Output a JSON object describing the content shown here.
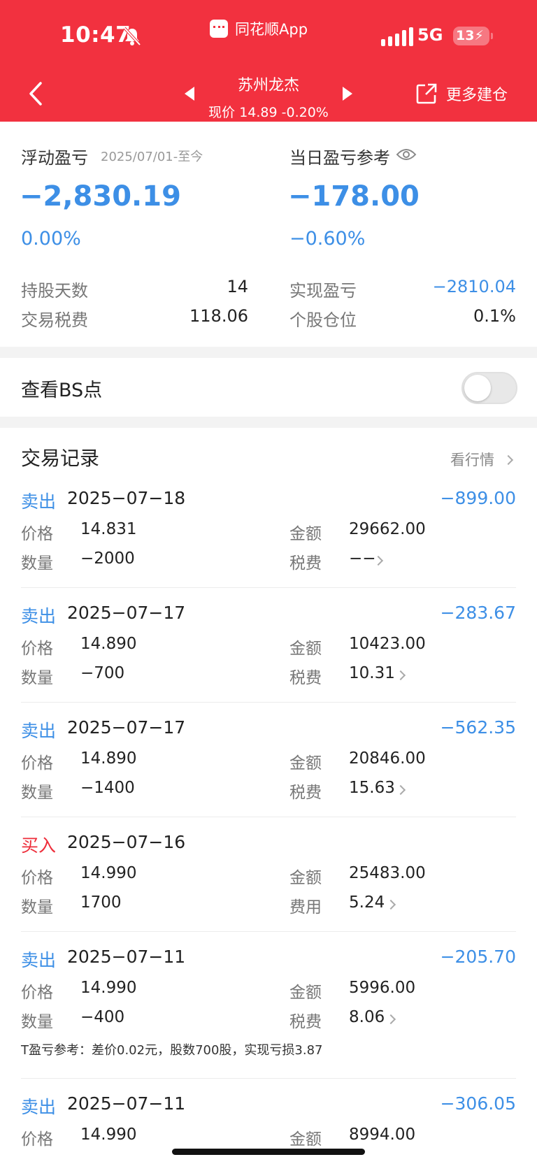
{
  "status_bar": {
    "time": "10:47",
    "network": "5G",
    "battery": "13"
  },
  "header": {
    "app_name": "同花顺App",
    "stock_name": "苏州龙杰",
    "price_line": "现价 14.89 -0.20%",
    "more_label": "更多建仓"
  },
  "summary": {
    "float_label": "浮动盈亏",
    "float_period": "2025/07/01-至今",
    "float_value": "−2,830.19",
    "float_pct": "0.00%",
    "daily_label": "当日盈亏参考",
    "daily_value": "−178.00",
    "daily_pct": "−0.60%",
    "hold_days_label": "持股天数",
    "hold_days_value": "14",
    "realized_label": "实现盈亏",
    "realized_value": "−2810.04",
    "fee_label": "交易税费",
    "fee_value": "118.06",
    "position_label": "个股仓位",
    "position_value": "0.1%"
  },
  "bs": {
    "label": "查看BS点",
    "enabled": false
  },
  "records": {
    "title": "交易记录",
    "market_link": "看行情",
    "labels": {
      "price": "价格",
      "qty": "数量",
      "amount": "金额"
    },
    "items": [
      {
        "type": "卖出",
        "date": "2025−07−18",
        "pl": "−899.00",
        "price": "14.831",
        "qty": "−2000",
        "amount": "29662.00",
        "fee_label": "税费",
        "fee": "−−",
        "side": "sell"
      },
      {
        "type": "卖出",
        "date": "2025−07−17",
        "pl": "−283.67",
        "price": "14.890",
        "qty": "−700",
        "amount": "10423.00",
        "fee_label": "税费",
        "fee": "10.31",
        "side": "sell"
      },
      {
        "type": "卖出",
        "date": "2025−07−17",
        "pl": "−562.35",
        "price": "14.890",
        "qty": "−1400",
        "amount": "20846.00",
        "fee_label": "税费",
        "fee": "15.63",
        "side": "sell"
      },
      {
        "type": "买入",
        "date": "2025−07−16",
        "pl": "",
        "price": "14.990",
        "qty": "1700",
        "amount": "25483.00",
        "fee_label": "费用",
        "fee": "5.24",
        "side": "buy"
      },
      {
        "type": "卖出",
        "date": "2025−07−11",
        "pl": "−205.70",
        "price": "14.990",
        "qty": "−400",
        "amount": "5996.00",
        "fee_label": "税费",
        "fee": "8.06",
        "side": "sell",
        "note": "T盈亏参考：差价0.02元，股数700股，实现亏损3.87"
      },
      {
        "type": "卖出",
        "date": "2025−07−11",
        "pl": "−306.05",
        "price": "14.990",
        "qty": "",
        "amount": "8994.00",
        "fee_label": "",
        "fee": "",
        "side": "sell"
      }
    ]
  },
  "colors": {
    "header_red": "#f2313f",
    "loss_blue": "#3d8fe6",
    "buy_red": "#ee2d3a"
  }
}
